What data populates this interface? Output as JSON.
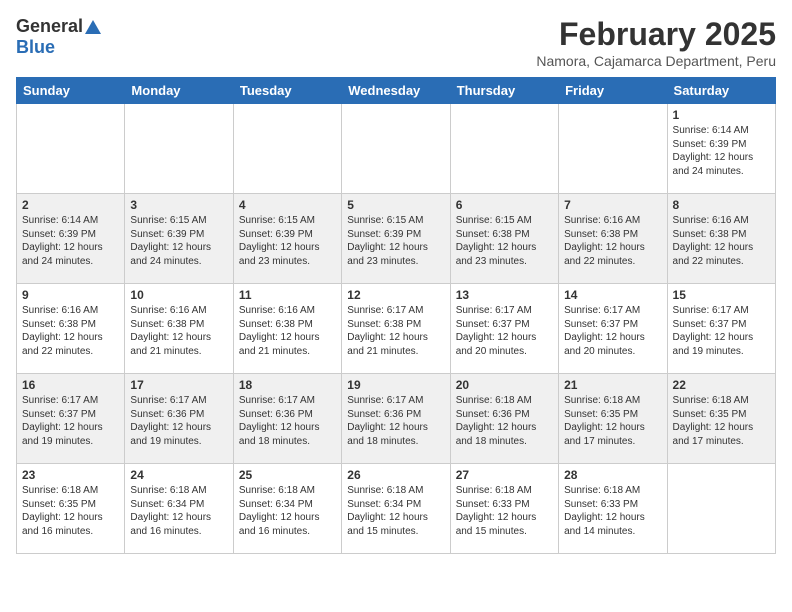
{
  "header": {
    "logo_general": "General",
    "logo_blue": "Blue",
    "title": "February 2025",
    "subtitle": "Namora, Cajamarca Department, Peru"
  },
  "weekdays": [
    "Sunday",
    "Monday",
    "Tuesday",
    "Wednesday",
    "Thursday",
    "Friday",
    "Saturday"
  ],
  "weeks": [
    [
      {
        "day": "",
        "info": ""
      },
      {
        "day": "",
        "info": ""
      },
      {
        "day": "",
        "info": ""
      },
      {
        "day": "",
        "info": ""
      },
      {
        "day": "",
        "info": ""
      },
      {
        "day": "",
        "info": ""
      },
      {
        "day": "1",
        "info": "Sunrise: 6:14 AM\nSunset: 6:39 PM\nDaylight: 12 hours\nand 24 minutes."
      }
    ],
    [
      {
        "day": "2",
        "info": "Sunrise: 6:14 AM\nSunset: 6:39 PM\nDaylight: 12 hours\nand 24 minutes."
      },
      {
        "day": "3",
        "info": "Sunrise: 6:15 AM\nSunset: 6:39 PM\nDaylight: 12 hours\nand 24 minutes."
      },
      {
        "day": "4",
        "info": "Sunrise: 6:15 AM\nSunset: 6:39 PM\nDaylight: 12 hours\nand 23 minutes."
      },
      {
        "day": "5",
        "info": "Sunrise: 6:15 AM\nSunset: 6:39 PM\nDaylight: 12 hours\nand 23 minutes."
      },
      {
        "day": "6",
        "info": "Sunrise: 6:15 AM\nSunset: 6:38 PM\nDaylight: 12 hours\nand 23 minutes."
      },
      {
        "day": "7",
        "info": "Sunrise: 6:16 AM\nSunset: 6:38 PM\nDaylight: 12 hours\nand 22 minutes."
      },
      {
        "day": "8",
        "info": "Sunrise: 6:16 AM\nSunset: 6:38 PM\nDaylight: 12 hours\nand 22 minutes."
      }
    ],
    [
      {
        "day": "9",
        "info": "Sunrise: 6:16 AM\nSunset: 6:38 PM\nDaylight: 12 hours\nand 22 minutes."
      },
      {
        "day": "10",
        "info": "Sunrise: 6:16 AM\nSunset: 6:38 PM\nDaylight: 12 hours\nand 21 minutes."
      },
      {
        "day": "11",
        "info": "Sunrise: 6:16 AM\nSunset: 6:38 PM\nDaylight: 12 hours\nand 21 minutes."
      },
      {
        "day": "12",
        "info": "Sunrise: 6:17 AM\nSunset: 6:38 PM\nDaylight: 12 hours\nand 21 minutes."
      },
      {
        "day": "13",
        "info": "Sunrise: 6:17 AM\nSunset: 6:37 PM\nDaylight: 12 hours\nand 20 minutes."
      },
      {
        "day": "14",
        "info": "Sunrise: 6:17 AM\nSunset: 6:37 PM\nDaylight: 12 hours\nand 20 minutes."
      },
      {
        "day": "15",
        "info": "Sunrise: 6:17 AM\nSunset: 6:37 PM\nDaylight: 12 hours\nand 19 minutes."
      }
    ],
    [
      {
        "day": "16",
        "info": "Sunrise: 6:17 AM\nSunset: 6:37 PM\nDaylight: 12 hours\nand 19 minutes."
      },
      {
        "day": "17",
        "info": "Sunrise: 6:17 AM\nSunset: 6:36 PM\nDaylight: 12 hours\nand 19 minutes."
      },
      {
        "day": "18",
        "info": "Sunrise: 6:17 AM\nSunset: 6:36 PM\nDaylight: 12 hours\nand 18 minutes."
      },
      {
        "day": "19",
        "info": "Sunrise: 6:17 AM\nSunset: 6:36 PM\nDaylight: 12 hours\nand 18 minutes."
      },
      {
        "day": "20",
        "info": "Sunrise: 6:18 AM\nSunset: 6:36 PM\nDaylight: 12 hours\nand 18 minutes."
      },
      {
        "day": "21",
        "info": "Sunrise: 6:18 AM\nSunset: 6:35 PM\nDaylight: 12 hours\nand 17 minutes."
      },
      {
        "day": "22",
        "info": "Sunrise: 6:18 AM\nSunset: 6:35 PM\nDaylight: 12 hours\nand 17 minutes."
      }
    ],
    [
      {
        "day": "23",
        "info": "Sunrise: 6:18 AM\nSunset: 6:35 PM\nDaylight: 12 hours\nand 16 minutes."
      },
      {
        "day": "24",
        "info": "Sunrise: 6:18 AM\nSunset: 6:34 PM\nDaylight: 12 hours\nand 16 minutes."
      },
      {
        "day": "25",
        "info": "Sunrise: 6:18 AM\nSunset: 6:34 PM\nDaylight: 12 hours\nand 16 minutes."
      },
      {
        "day": "26",
        "info": "Sunrise: 6:18 AM\nSunset: 6:34 PM\nDaylight: 12 hours\nand 15 minutes."
      },
      {
        "day": "27",
        "info": "Sunrise: 6:18 AM\nSunset: 6:33 PM\nDaylight: 12 hours\nand 15 minutes."
      },
      {
        "day": "28",
        "info": "Sunrise: 6:18 AM\nSunset: 6:33 PM\nDaylight: 12 hours\nand 14 minutes."
      },
      {
        "day": "",
        "info": ""
      }
    ]
  ]
}
